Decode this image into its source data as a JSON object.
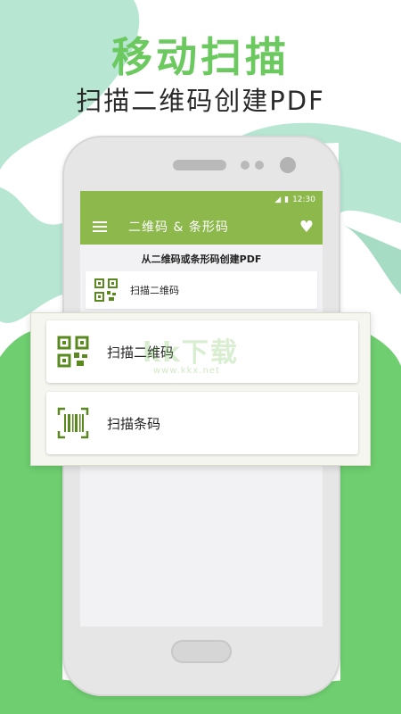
{
  "header": {
    "title": "移动扫描",
    "subtitle": "扫描二维码创建PDF"
  },
  "status_bar": {
    "time": "12:30"
  },
  "app_bar": {
    "title": "二维码 & 条形码"
  },
  "screen": {
    "instruction": "从二维码或条形码创建PDF",
    "first_item_label": "扫描二维码"
  },
  "popup": {
    "items": [
      {
        "label": "扫描二维码",
        "icon": "qr-code-icon"
      },
      {
        "label": "扫描条码",
        "icon": "barcode-icon"
      }
    ]
  },
  "watermark": {
    "text": "kk下载",
    "url": "www.kkx.net"
  },
  "colors": {
    "headline": "#6cc960",
    "app_bar": "#8cb84c",
    "background_mint": "#b7e6d3",
    "background_green": "#6fcf70",
    "icon_green": "#5a8a1f"
  }
}
